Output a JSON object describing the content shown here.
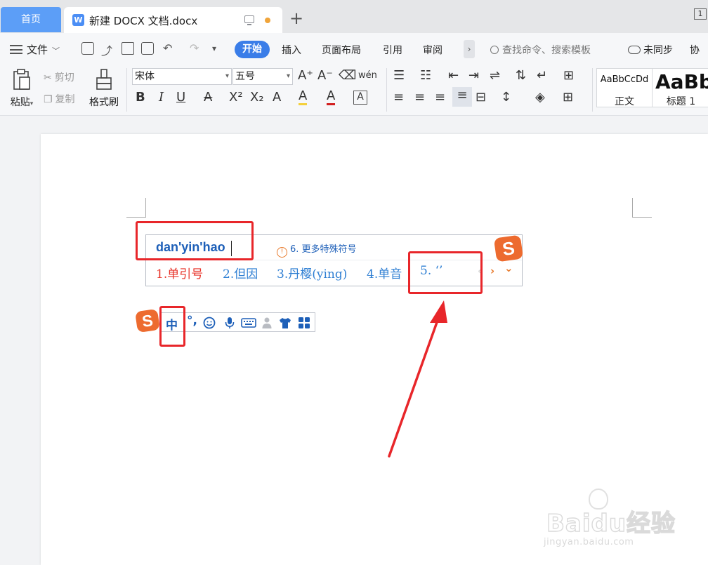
{
  "tabs": {
    "home_label": "首页",
    "doc_icon": "W",
    "doc_title": "新建 DOCX 文档.docx",
    "new_tab": "+",
    "window_badge": "1"
  },
  "menubar": {
    "file_label": "文件",
    "ribbon_tabs": [
      "开始",
      "插入",
      "页面布局",
      "引用",
      "审阅"
    ],
    "more": "›",
    "search_placeholder": "查找命令、搜索模板",
    "sync_label": "未同步",
    "collab_label": "协"
  },
  "ribbon": {
    "paste_label": "粘贴",
    "cut_label": "剪切",
    "copy_label": "复制",
    "format_painter_label": "格式刷",
    "font_name": "宋体",
    "font_size": "五号",
    "grow_font": "A⁺",
    "shrink_font": "A⁻",
    "pinyin_guide": "wén",
    "bold": "B",
    "italic": "I",
    "underline": "U",
    "strike": "A",
    "superscript": "X²",
    "subscript": "X₂",
    "text_effect": "A",
    "highlight": "A",
    "font_color": "A",
    "char_border": "A",
    "styles": [
      {
        "sample": "AaBbCcDd",
        "name": "正文"
      },
      {
        "sample": "AaBb",
        "name": "标题 1"
      }
    ]
  },
  "ime": {
    "input_text": "dan'yin'hao",
    "more_symbols": "6. 更多特殊符号",
    "candidates": [
      {
        "num": "1.",
        "text": "单引号"
      },
      {
        "num": "2.",
        "text": "但因"
      },
      {
        "num": "3.",
        "text": "丹樱(ying)"
      },
      {
        "num": "4.",
        "text": "单音"
      },
      {
        "num": "5.",
        "text": "‘’"
      }
    ],
    "prev": "‹",
    "next": "›",
    "expand": "⌄",
    "logo_letter": "S"
  },
  "ime_bar": {
    "mode_label": "中",
    "punct_label": "°,"
  },
  "colors": {
    "accent": "#3a7de8",
    "home_tab": "#5c9ef7",
    "candidate_first": "#e8342a",
    "candidate": "#2f7fd3",
    "ime_logo": "#ed6b2f",
    "annotation": "#e8262a"
  },
  "watermark": {
    "brand": "Baidu经验",
    "url": "jingyan.baidu.com"
  }
}
